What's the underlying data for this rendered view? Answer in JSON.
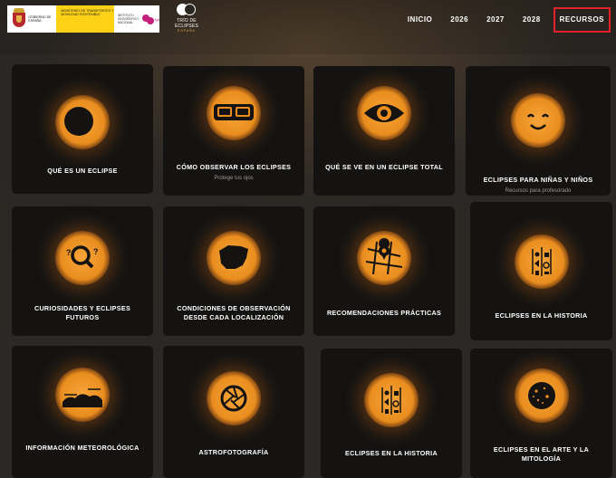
{
  "header": {
    "gov_logo": {
      "ministry_left": "GOBIERNO DE ESPAÑA",
      "ministry_right": "MINISTERIO DE TRANSPORTES Y MOVILIDAD SOSTENIBLE",
      "agency": "INSTITUTO GEOGRÁFICO NACIONAL",
      "mark": "ign"
    },
    "trio_logo": {
      "name": "TRÍO DE ECLIPSES",
      "country": "ESPAÑA"
    }
  },
  "nav": {
    "items": [
      "INICIO",
      "2026",
      "2027",
      "2028"
    ],
    "highlighted": "RECURSOS"
  },
  "cards": [
    {
      "title": "QUÉ ES UN ECLIPSE",
      "icon": "eclipse-icon"
    },
    {
      "title": "CÓMO OBSERVAR LOS ECLIPSES",
      "subtitle": "Protege tus ojos",
      "icon": "eclipse-glasses-icon"
    },
    {
      "title": "QUÉ SE VE EN UN ECLIPSE TOTAL",
      "icon": "eye-icon"
    },
    {
      "title": "ECLIPSES PARA NIÑAS Y NIÑOS",
      "subtitle": "Recursos para profesorado",
      "icon": "smiley-face-icon"
    },
    {
      "title": "CURIOSIDADES Y ECLIPSES FUTUROS",
      "icon": "magnifier-question-icon"
    },
    {
      "title": "CONDICIONES DE OBSERVACIÓN DESDE CADA LOCALIZACIÓN",
      "icon": "iberia-map-icon"
    },
    {
      "title": "RECOMENDACIONES PRÁCTICAS",
      "icon": "map-pin-icon"
    },
    {
      "title": "ECLIPSES EN LA HISTORIA",
      "icon": "hieroglyphs-icon"
    },
    {
      "title": "INFORMACIÓN METEOROLÓGICA",
      "icon": "clouds-icon"
    },
    {
      "title": "ASTROFOTOGRAFÍA",
      "icon": "camera-aperture-icon"
    },
    {
      "title": "ECLIPSES EN LA HISTORIA",
      "icon": "hieroglyphs-icon"
    },
    {
      "title": "ECLIPSES EN EL ARTE Y LA MITOLOGÍA",
      "icon": "starry-sphere-icon"
    }
  ],
  "colors": {
    "accent": "#e98d1e",
    "highlight_border": "#e3212b",
    "card_bg": "#141312",
    "page_bg": "#2a2622"
  }
}
